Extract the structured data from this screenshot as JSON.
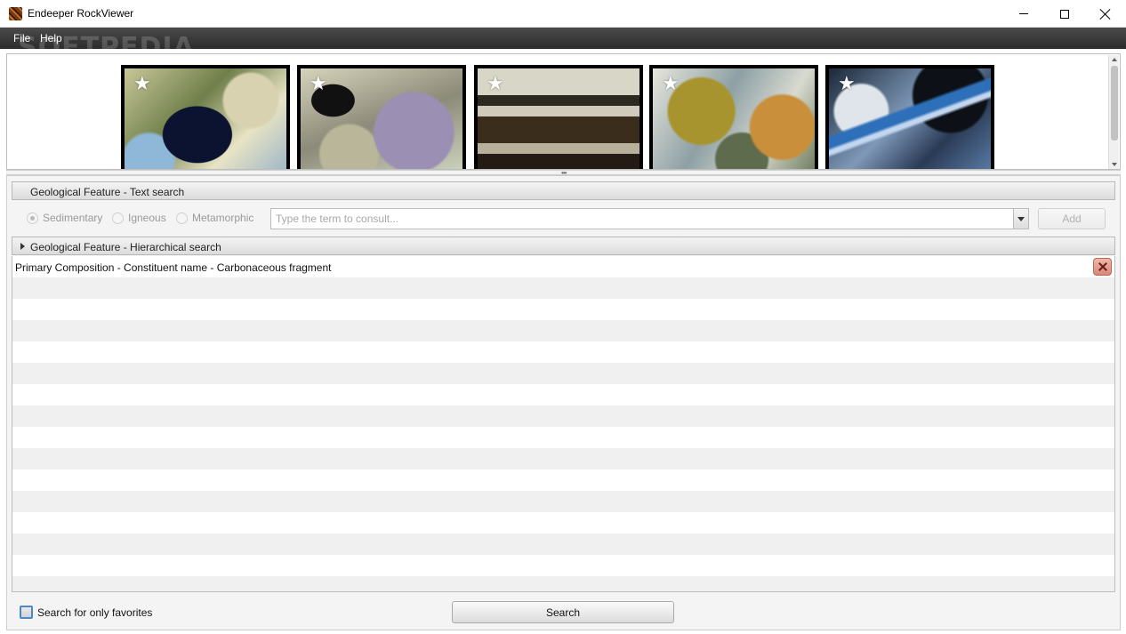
{
  "window": {
    "title": "Endeeper RockViewer"
  },
  "menu": {
    "file": "File",
    "help": "Help"
  },
  "watermark": "SOFTPEDIA",
  "gallery": {
    "thumbnails": [
      {
        "favorite_icon": "star-icon"
      },
      {
        "favorite_icon": "star-icon"
      },
      {
        "favorite_icon": "star-icon"
      },
      {
        "favorite_icon": "star-icon"
      },
      {
        "favorite_icon": "star-icon"
      }
    ]
  },
  "text_search": {
    "header": "Geological Feature - Text search",
    "radios": [
      {
        "label": "Sedimentary",
        "selected": true,
        "enabled": false
      },
      {
        "label": "Igneous",
        "selected": false,
        "enabled": false
      },
      {
        "label": "Metamorphic",
        "selected": false,
        "enabled": false
      }
    ],
    "input_placeholder": "Type the term to consult...",
    "input_value": "",
    "add_button": "Add"
  },
  "hierarchical_search": {
    "header": "Geological Feature - Hierarchical search",
    "expanded": false
  },
  "criteria_list": {
    "items": [
      {
        "text": "Primary Composition - Constituent name - Carbonaceous fragment",
        "removable": true
      }
    ]
  },
  "footer": {
    "favorites_checkbox_label": "Search for only favorites",
    "favorites_checked": false,
    "search_button": "Search"
  },
  "colors": {
    "menubar": "#3a3a3a",
    "remove_button": "#e09a8c",
    "checkbox_border": "#4a88c9"
  }
}
